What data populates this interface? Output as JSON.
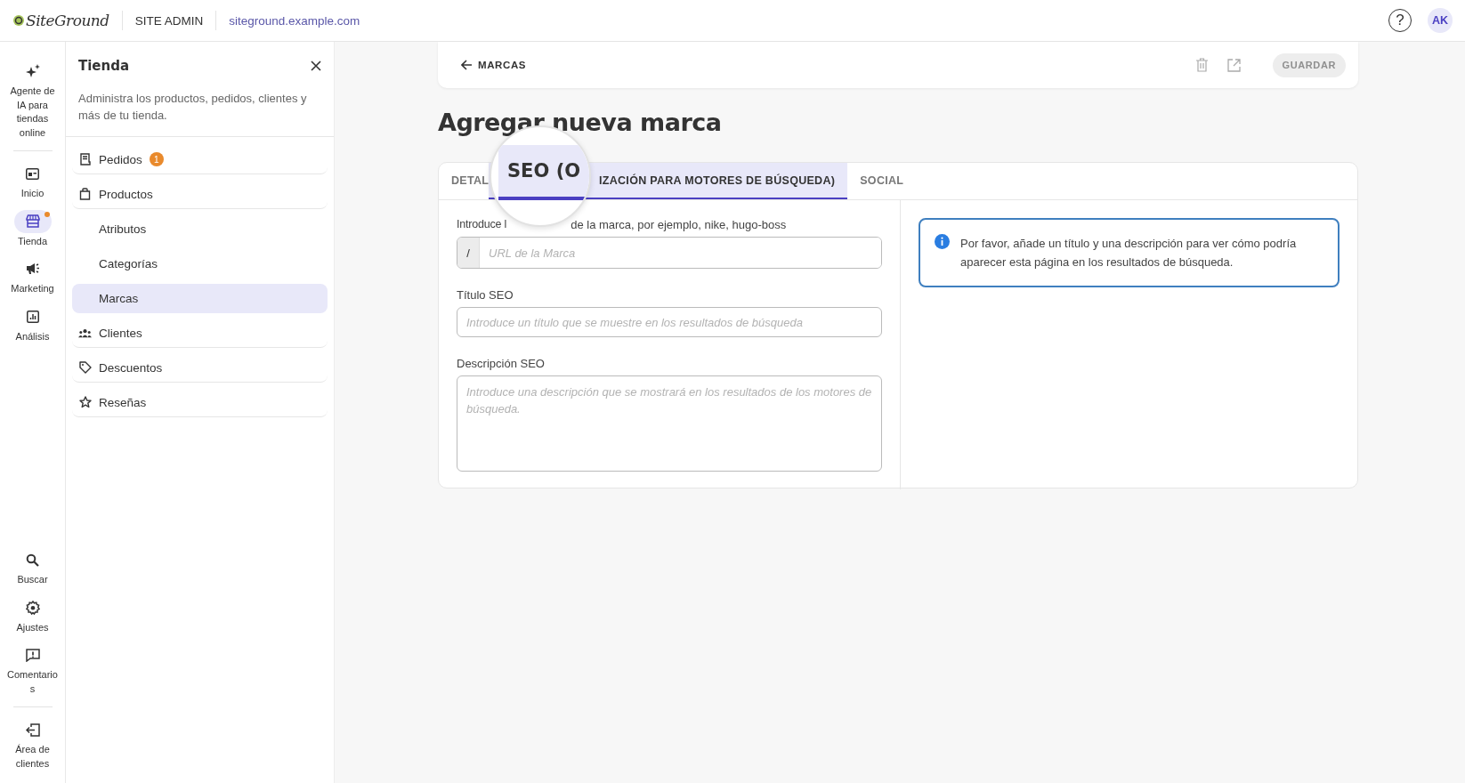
{
  "header": {
    "logo": "SiteGround",
    "section": "SITE ADMIN",
    "domain": "siteground.example.com",
    "help": "?",
    "avatar": "AK"
  },
  "rail": {
    "top": [
      {
        "label": "Agente de IA para tiendas online",
        "selected": false,
        "notify": false
      },
      {
        "label": "Inicio",
        "selected": false,
        "notify": false
      },
      {
        "label": "Tienda",
        "selected": true,
        "notify": true
      },
      {
        "label": "Marketing",
        "selected": false,
        "notify": false
      },
      {
        "label": "Análisis",
        "selected": false,
        "notify": false
      }
    ],
    "bottom": [
      {
        "label": "Buscar"
      },
      {
        "label": "Ajustes"
      },
      {
        "label": "Comentarios"
      },
      {
        "label": "Área de clientes"
      }
    ]
  },
  "panel": {
    "title": "Tienda",
    "description": "Administra los productos, pedidos, clientes y más de tu tienda.",
    "items": [
      {
        "kind": "item",
        "label": "Pedidos",
        "badge": "1",
        "selected": false
      },
      {
        "kind": "item",
        "label": "Productos",
        "selected": false
      },
      {
        "kind": "subitem",
        "label": "Atributos",
        "selected": false
      },
      {
        "kind": "subitem",
        "label": "Categorías",
        "selected": false
      },
      {
        "kind": "subitem",
        "label": "Marcas",
        "selected": true
      },
      {
        "kind": "item",
        "label": "Clientes",
        "selected": false
      },
      {
        "kind": "item",
        "label": "Descuentos",
        "selected": false
      },
      {
        "kind": "item",
        "label": "Reseñas",
        "selected": false
      }
    ]
  },
  "toolbar": {
    "back": "MARCAS",
    "save": {
      "label": "GUARDAR",
      "disabled": true
    }
  },
  "title": "Agregar nueva marca",
  "tabs": [
    {
      "label": "DETAL",
      "selected": false
    },
    {
      "label": "IZACIÓN PARA MOTORES DE BÚSQUEDA)",
      "selected": true
    },
    {
      "label": "SOCIAL",
      "selected": false
    }
  ],
  "magnifier": {
    "text": "SEO (O"
  },
  "form": {
    "url_label_start": "Introduce l",
    "url_label_end": "de la marca, por ejemplo, nike, hugo-boss",
    "url_prefix": "/",
    "url_placeholder": "URL de la Marca",
    "title_label": "Título SEO",
    "title_placeholder": "Introduce un título que se muestre en los resultados de búsqueda",
    "description_label": "Descripción SEO",
    "description_placeholder": "Introduce una descripción que se mostrará en los resultados de los motores de búsqueda."
  },
  "info": "Por favor, añade un título y una descripción para ver cómo podría aparecer esta página en los resultados de búsqueda."
}
